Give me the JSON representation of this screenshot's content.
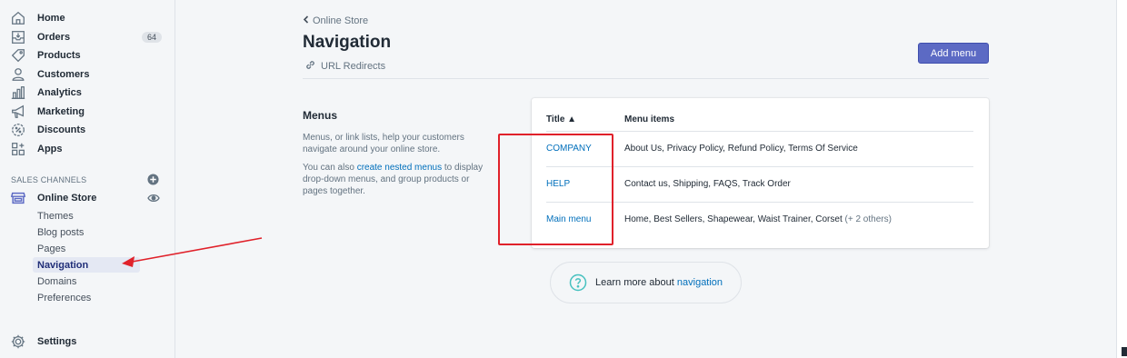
{
  "sidebar": {
    "items": [
      {
        "label": "Home",
        "icon": "home-icon"
      },
      {
        "label": "Orders",
        "icon": "orders-icon",
        "badge": "64"
      },
      {
        "label": "Products",
        "icon": "tag-icon"
      },
      {
        "label": "Customers",
        "icon": "person-icon"
      },
      {
        "label": "Analytics",
        "icon": "bar-chart-icon"
      },
      {
        "label": "Marketing",
        "icon": "megaphone-icon"
      },
      {
        "label": "Discounts",
        "icon": "discount-icon"
      },
      {
        "label": "Apps",
        "icon": "apps-icon"
      }
    ],
    "sales_channels_heading": "SALES CHANNELS",
    "online_store": {
      "label": "Online Store",
      "icon": "store-icon"
    },
    "sub_items": [
      "Themes",
      "Blog posts",
      "Pages",
      "Navigation",
      "Domains",
      "Preferences"
    ],
    "active_sub_item": "Navigation",
    "settings": {
      "label": "Settings",
      "icon": "gear-icon"
    }
  },
  "header": {
    "back_label": "Online Store",
    "title": "Navigation",
    "url_redirects": "URL Redirects",
    "add_menu": "Add menu"
  },
  "menus_section": {
    "heading": "Menus",
    "description": "Menus, or link lists, help your customers navigate around your online store.",
    "nested_prefix": "You can also ",
    "nested_link": "create nested menus",
    "nested_suffix": " to display drop-down menus, and group products or pages together."
  },
  "table": {
    "col_title": "Title ▲",
    "col_items": "Menu items",
    "rows": [
      {
        "title": "COMPANY",
        "items": "About Us, Privacy Policy, Refund Policy, Terms Of Service",
        "more": ""
      },
      {
        "title": "HELP",
        "items": "Contact us, Shipping, FAQS, Track Order",
        "more": ""
      },
      {
        "title": "Main menu",
        "items": "Home, Best Sellers, Shapewear, Waist Trainer, Corset",
        "more": "(+ 2 others)"
      }
    ]
  },
  "learn_more": {
    "prefix": "Learn more about ",
    "link": "navigation"
  },
  "colors": {
    "accent": "#5c6ac4",
    "link": "#006fbb",
    "annotation": "#e0212a",
    "help_icon": "#47c1bf"
  }
}
